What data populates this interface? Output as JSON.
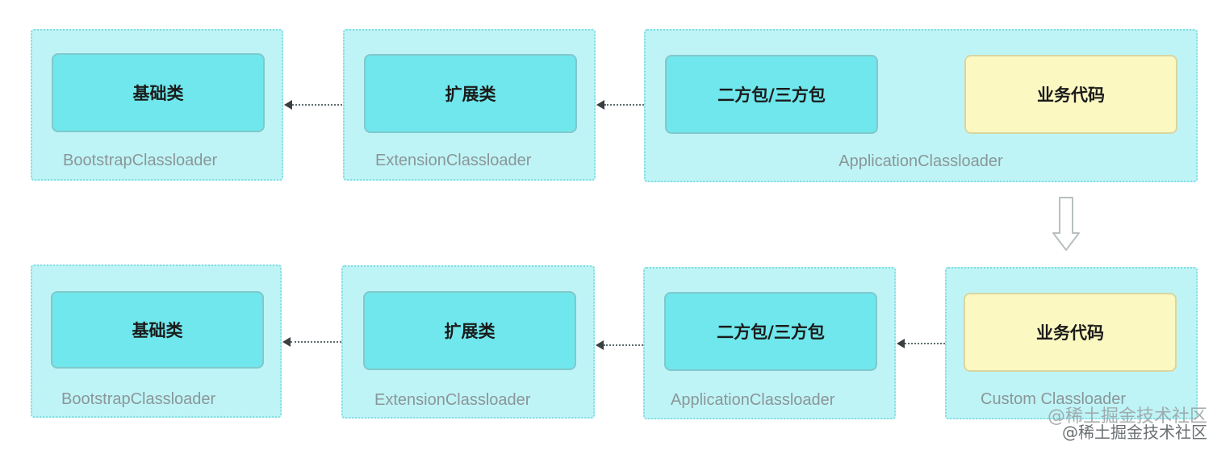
{
  "top_row": {
    "bootstrap": {
      "box_label": "基础类",
      "caption": "BootstrapClassloader"
    },
    "extension": {
      "box_label": "扩展类",
      "caption": "ExtensionClassloader"
    },
    "application": {
      "box_left_label": "二方包/三方包",
      "box_right_label": "业务代码",
      "caption": "ApplicationClassloader"
    }
  },
  "bottom_row": {
    "bootstrap": {
      "box_label": "基础类",
      "caption": "BootstrapClassloader"
    },
    "extension": {
      "box_label": "扩展类",
      "caption": "ExtensionClassloader"
    },
    "application": {
      "box_label": "二方包/三方包",
      "caption": "ApplicationClassloader"
    },
    "custom": {
      "box_label": "业务代码",
      "caption": "Custom Classloader"
    }
  },
  "watermark": {
    "line1": "@稀土掘金技术社区",
    "line2": "@稀土掘金技术社区"
  },
  "colors": {
    "group_fill": "#bff4f6",
    "box_cyan": "#6fe7ec",
    "box_yellow": "#fbf8c2"
  }
}
